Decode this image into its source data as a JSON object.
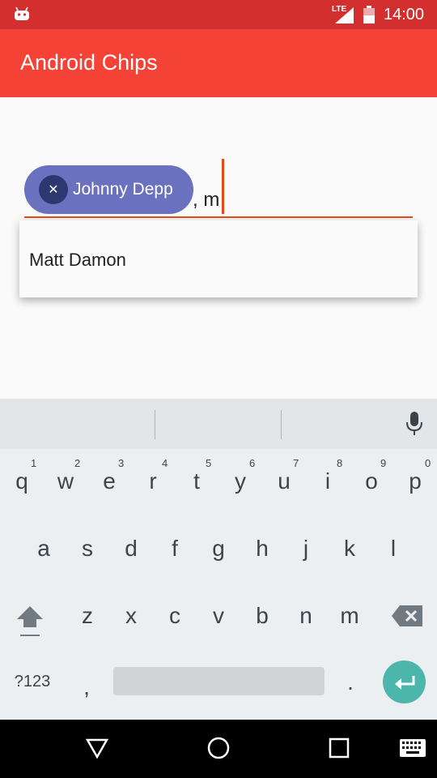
{
  "status_bar": {
    "time": "14:00",
    "network": "LTE"
  },
  "app_bar": {
    "title": "Android Chips"
  },
  "chips_input": {
    "chip_label": "Johnny Depp",
    "typed_text": ", m"
  },
  "suggestions": [
    {
      "label": "Matt Damon"
    }
  ],
  "keyboard": {
    "row1": [
      "q",
      "w",
      "e",
      "r",
      "t",
      "y",
      "u",
      "i",
      "o",
      "p"
    ],
    "row1_digits": [
      "1",
      "2",
      "3",
      "4",
      "5",
      "6",
      "7",
      "8",
      "9",
      "0"
    ],
    "row2": [
      "a",
      "s",
      "d",
      "f",
      "g",
      "h",
      "j",
      "k",
      "l"
    ],
    "row3": [
      "z",
      "x",
      "c",
      "v",
      "b",
      "n",
      "m"
    ],
    "symbols_label": "?123",
    "comma": ",",
    "period": "."
  },
  "colors": {
    "status_bar": "#d32f2f",
    "app_bar": "#f44336",
    "chip": "#6a71be",
    "accent": "#e64a19",
    "enter_key": "#4db6ac"
  },
  "icons": {
    "status": [
      "android-icon",
      "signal-icon",
      "battery-icon"
    ],
    "chip": "close-icon",
    "keyboard": [
      "mic-icon",
      "shift-icon",
      "backspace-icon",
      "enter-icon"
    ],
    "nav": [
      "back-icon",
      "home-icon",
      "recents-icon",
      "keyboard-switch-icon"
    ]
  }
}
